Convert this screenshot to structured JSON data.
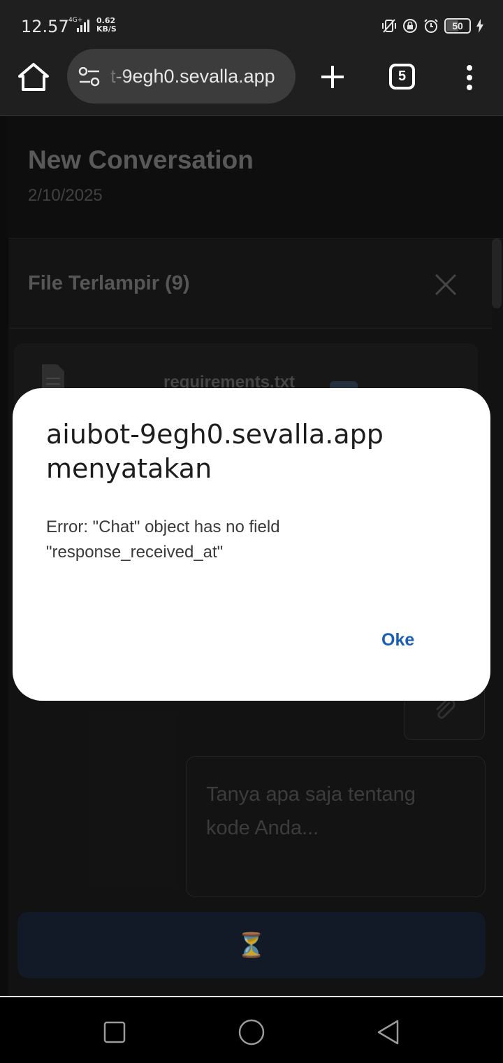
{
  "status_bar": {
    "time": "12.57",
    "network_tag": "4G+",
    "speed_value": "0.62",
    "speed_unit": "KB/S",
    "battery_level": "50",
    "icons": [
      "vibrate-icon",
      "rotation-lock-icon",
      "alarm-icon",
      "battery-icon",
      "charging-icon"
    ]
  },
  "browser": {
    "url_text": "t-9egh0.sevalla.app",
    "tab_count": "5",
    "icons": [
      "home-icon",
      "site-settings-icon",
      "new-tab-icon",
      "tab-switcher",
      "menu-icon"
    ]
  },
  "page": {
    "conversation_title": "New Conversation",
    "conversation_date": "2/10/2025",
    "files_title": "File Terlampir (9)",
    "file_name": "requirements.txt",
    "prompt_placeholder": "Tanya apa saja tentang kode Anda...",
    "send_icon": "⏳"
  },
  "dialog": {
    "title": "aiubot-9egh0.sevalla.app menyatakan",
    "message": "Error: \"Chat\" object has no field \"response_received_at\"",
    "ok_label": "Oke"
  },
  "colors": {
    "dialog_bg": "#ffffff",
    "accent": "#1a5fb4",
    "page_bg": "#171717"
  }
}
